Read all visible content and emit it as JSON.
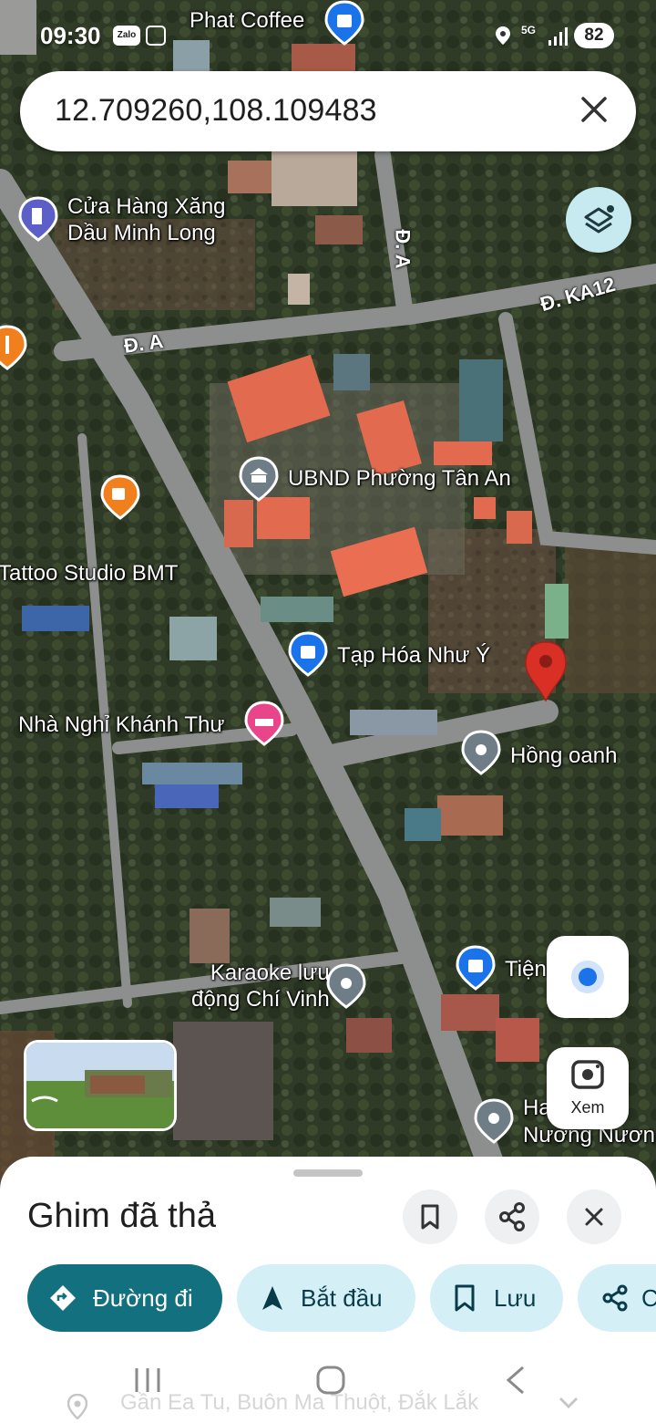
{
  "status_bar": {
    "time": "09:30",
    "zalo_label": "Zalo",
    "network": "5G",
    "battery": "82"
  },
  "search": {
    "query": "12.709260,108.109483"
  },
  "map": {
    "roads": [
      "Đ. A",
      "Đ. A",
      "Đ. KA12"
    ],
    "places": [
      {
        "name": "Phat Coffee",
        "icon": "shopping-bag-icon"
      },
      {
        "name": "Cửa Hàng Xăng\nDầu Minh Long",
        "icon": "gas-station-icon"
      },
      {
        "name": "UBND Phường Tân An",
        "icon": "government-building-icon"
      },
      {
        "name": "Tattoo Studio BMT",
        "icon": "coffee-cup-icon"
      },
      {
        "name": "Tạp Hóa Như Ý",
        "icon": "shopping-bag-icon"
      },
      {
        "name": "Nhà Nghỉ Khánh Thư",
        "icon": "bed-icon"
      },
      {
        "name": "Hồng oanh",
        "icon": "place-icon"
      },
      {
        "name": "Karaoke lưu\nđộng Chí Vinh",
        "icon": "place-icon"
      },
      {
        "name": "Tiện",
        "icon": "shopping-bag-icon"
      },
      {
        "name": "Ha",
        "icon": "place-icon"
      },
      {
        "name": "Nương Nươn",
        "icon": "place-icon"
      }
    ]
  },
  "controls": {
    "lens_label": "Xem"
  },
  "sheet": {
    "title": "Ghim đã thả",
    "actions": {
      "directions": "Đường đi",
      "start": "Bắt đầu",
      "save": "Lưu",
      "share": "C"
    },
    "location_hint": "Gần Ea Tu, Buôn Ma Thuột, Đắk Lắk"
  },
  "colors": {
    "primary_chip": "#13707e",
    "chip": "#d4f0f6",
    "dropped_pin": "#d93025",
    "place_pin_blue": "#1a73e8",
    "lodging_pink": "#e8458a",
    "food_orange": "#f07f1e"
  }
}
